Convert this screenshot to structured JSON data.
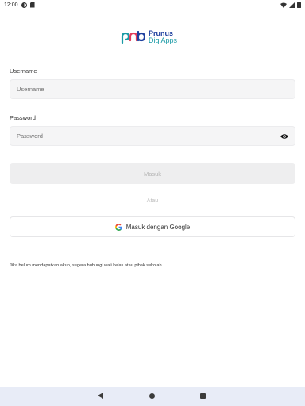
{
  "status_bar": {
    "time": "12:00",
    "icons": [
      "data-saver-icon",
      "sim-card-icon",
      "wifi-icon",
      "signal-icon",
      "battery-icon"
    ]
  },
  "logo": {
    "line1": "Prunus",
    "line2": "DigiApps",
    "colors": {
      "primary": "#1d3f9e",
      "secondary": "#1a9aa6",
      "accent": "#e23b5a"
    }
  },
  "form": {
    "username_label": "Username",
    "username_placeholder": "Username",
    "username_value": "",
    "password_label": "Password",
    "password_placeholder": "Password",
    "password_value": "",
    "submit_label": "Masuk",
    "divider_text": "Atau",
    "google_label": "Masuk dengan Google"
  },
  "info_text": "Jika belum mendapatkan akun, segera hubungi wali kelas atau pihak sekolah.",
  "nav_bar": {
    "icons": [
      "back-icon",
      "home-icon",
      "recents-icon"
    ]
  }
}
